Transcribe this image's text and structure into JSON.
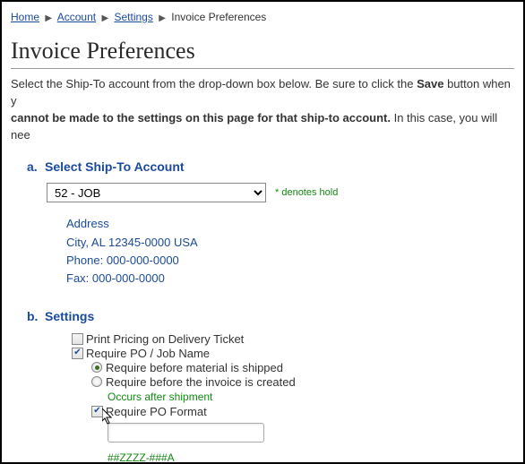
{
  "breadcrumb": {
    "home": "Home",
    "account": "Account",
    "settings": "Settings",
    "current": "Invoice Preferences"
  },
  "page_title": "Invoice Preferences",
  "intro": {
    "part1": "Select the Ship-To account from the drop-down box below. Be sure to click the ",
    "save": "Save",
    "part2": " button when y",
    "bold2": "cannot be made to the settings on this page for that ship-to account.",
    "part3": " In this case, you will nee"
  },
  "section_a": {
    "letter": "a.",
    "title": "Select Ship-To Account",
    "selected": "52 - JOB",
    "hold_note": "* denotes hold",
    "address": {
      "line1": "Address",
      "line2": "City,  AL  12345-0000  USA",
      "phone": "Phone: 000-000-0000",
      "fax": "Fax: 000-000-0000"
    }
  },
  "section_b": {
    "letter": "b.",
    "title": "Settings",
    "print_pricing": "Print Pricing on Delivery Ticket",
    "require_po": "Require PO / Job Name",
    "req_before_ship": "Require before material is shipped",
    "req_before_invoice": "Require before the invoice is created",
    "occurs": "Occurs after shipment",
    "require_format": "Require PO Format",
    "po_value": "",
    "mask": "##ZZZZ-###A"
  }
}
